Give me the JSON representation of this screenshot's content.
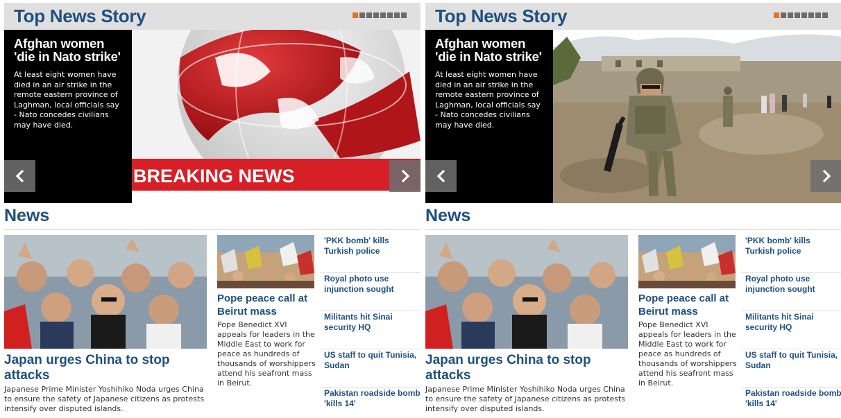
{
  "top_news": {
    "title": "Top News Story",
    "pager": {
      "total": 8,
      "active_index": 0
    },
    "headline": "Afghan women 'die in Nato strike'",
    "summary": "At least eight women have died in an air strike in the remote eastern province of Laghman, local officials say - Nato concedes civilians may have died."
  },
  "breaking_banner": "BREAKING NEWS",
  "news": {
    "title": "News",
    "lead": {
      "headline": "Japan urges China to stop attacks",
      "summary": "Japanese Prime Minister Yoshihiko Noda urges China to ensure the safety of Japanese citizens as protests intensify over disputed islands."
    },
    "second": {
      "headline": "Pope peace call at Beirut mass",
      "summary": "Pope Benedict XVI appeals for leaders in the Middle East to work for peace as hundreds of thousands of worshippers attend his seafront mass in Beirut."
    },
    "headlines": [
      "'PKK bomb' kills Turkish police",
      "Royal photo use injunction sought",
      "Militants hit Sinai security HQ",
      "US staff to quit Tunisia, Sudan",
      "Pakistan roadside bomb 'kills 14'"
    ]
  },
  "colors": {
    "brand_blue": "#1f4f80",
    "pager_active": "#e8741a",
    "pager_inactive": "#6b6b6b",
    "breaking_red": "#d61f26"
  },
  "icons": {
    "prev": "chevron-left-icon",
    "next": "chevron-right-icon"
  }
}
